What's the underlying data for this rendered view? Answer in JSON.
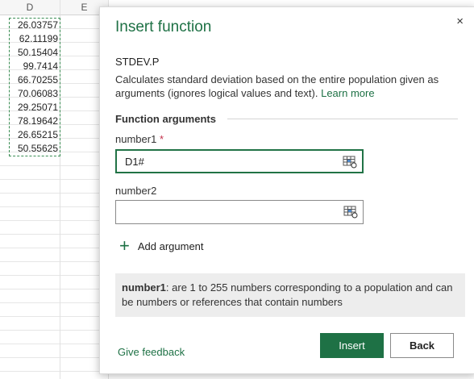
{
  "sheet": {
    "columns": [
      "D",
      "E"
    ],
    "cells": [
      "26.03757",
      "62.11199",
      "50.15404",
      "99.7414",
      "66.70255",
      "70.06083",
      "29.25071",
      "78.19642",
      "26.65215",
      "50.55625"
    ]
  },
  "dialog": {
    "title": "Insert function",
    "close_label": "×",
    "function_name": "STDEV.P",
    "description": "Calculates standard deviation based on the entire population given as arguments (ignores logical values and text).",
    "learn_more": "Learn more",
    "section_label": "Function arguments",
    "arguments": [
      {
        "label": "number1",
        "required_mark": "*",
        "value": "D1#"
      },
      {
        "label": "number2",
        "required_mark": "",
        "value": ""
      }
    ],
    "add_argument_label": "Add argument",
    "help": {
      "term": "number1",
      "text": ": are 1 to 255 numbers corresponding to a population and can be numbers or references that contain numbers"
    },
    "feedback_label": "Give feedback",
    "insert_label": "Insert",
    "back_label": "Back"
  },
  "colors": {
    "accent": "#1e7145",
    "required": "#c4314b"
  },
  "icons": {
    "close": "close-icon",
    "ref": "range-select-icon",
    "add": "plus-icon"
  }
}
